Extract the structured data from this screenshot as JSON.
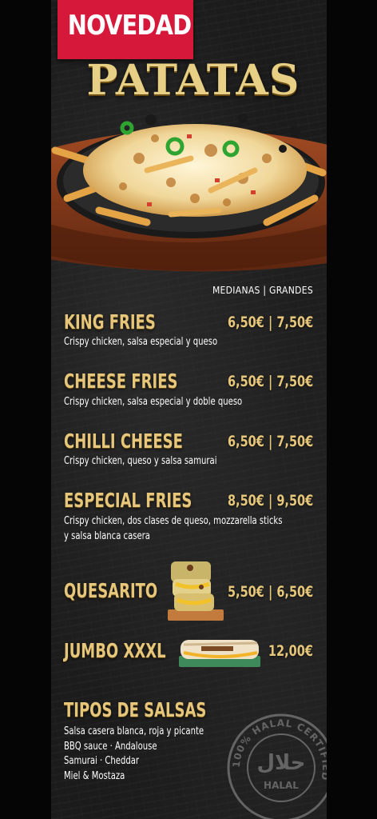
{
  "badge": "NOVEDAD",
  "title": "PATATAS",
  "column_header": "MEDIANAS | GRANDES",
  "items": [
    {
      "name": "KING FRIES",
      "price": "6,50€ | 7,50€",
      "desc": [
        "Crispy chicken, salsa especial y queso"
      ]
    },
    {
      "name": "CHEESE FRIES",
      "price": "6,50€ | 7,50€",
      "desc": [
        "Crispy chicken, salsa especial y doble queso"
      ]
    },
    {
      "name": "CHILLI CHEESE",
      "price": "6,50€ | 7,50€",
      "desc": [
        "Crispy chicken, queso y salsa samurai"
      ]
    },
    {
      "name": "ESPECIAL FRIES",
      "price": "8,50€ | 9,50€",
      "desc": [
        "Crispy chicken, dos clases de queso, mozzarella sticks",
        "y salsa blanca casera"
      ]
    },
    {
      "name": "QUESARITO",
      "price": "5,50€ | 6,50€"
    },
    {
      "name": "JUMBO XXXL",
      "price": "12,00€"
    }
  ],
  "sauces": {
    "title": "TIPOS DE SALSAS",
    "lines": [
      "Salsa casera blanca, roja y picante",
      "BBQ sauce  ·  Andalouse",
      "Samurai  ·  Cheddar",
      "Miel & Mostaza"
    ]
  },
  "halal_stamp": {
    "ring_text": "100% HALAL CERTIFIED",
    "center_arabic": "حلال",
    "center_label": "HALAL"
  },
  "colors": {
    "gold": "#e6c67a",
    "badge_red": "#d6183a",
    "panel": "#1b1b1b"
  }
}
